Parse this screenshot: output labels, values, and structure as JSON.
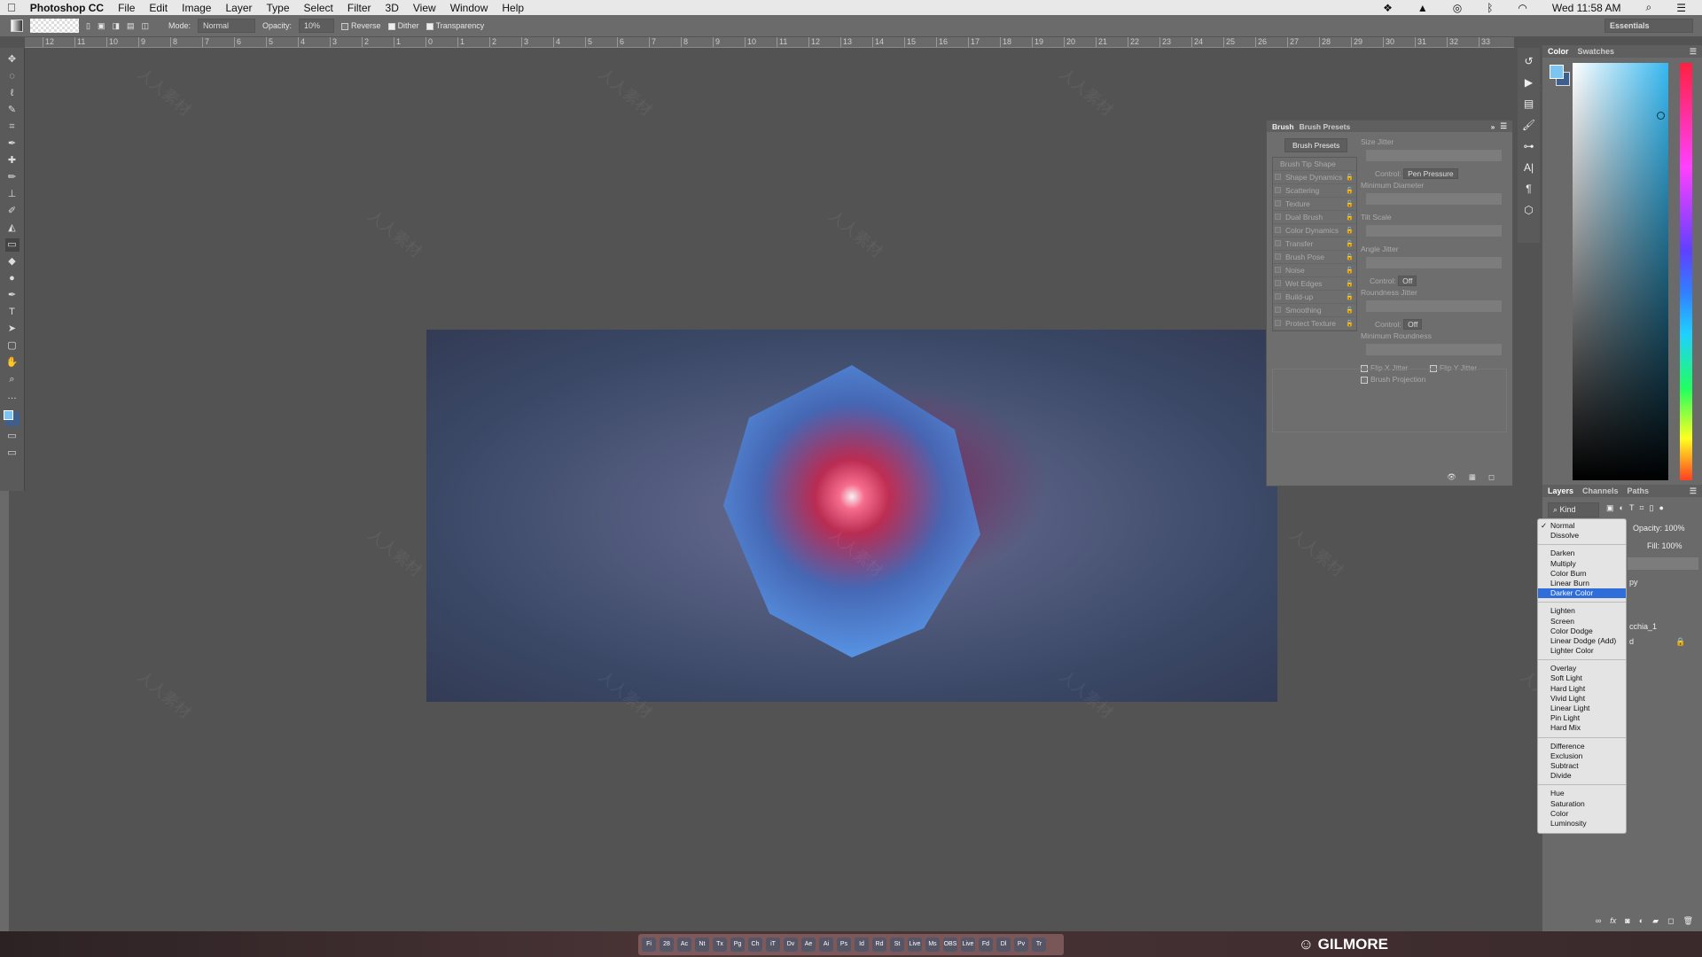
{
  "menubar": {
    "app": "Photoshop CC",
    "items": [
      "File",
      "Edit",
      "Image",
      "Layer",
      "Type",
      "Select",
      "Filter",
      "3D",
      "View",
      "Window",
      "Help"
    ],
    "clock": "Wed 11:58 AM",
    "status_icons": [
      "dropbox-icon",
      "drive-icon",
      "creative-cloud-icon",
      "bluetooth-icon",
      "wifi-icon",
      "search-icon",
      "list-icon"
    ]
  },
  "options": {
    "mode_label": "Mode:",
    "mode_value": "Normal",
    "opacity_label": "Opacity:",
    "opacity_value": "10%",
    "reverse": "Reverse",
    "reverse_checked": false,
    "dither": "Dither",
    "dither_checked": true,
    "transparency": "Transparency",
    "transparency_checked": true,
    "workspace": "Essentials"
  },
  "ruler": [
    "12",
    "11",
    "10",
    "9",
    "8",
    "7",
    "6",
    "5",
    "4",
    "3",
    "2",
    "1",
    "0",
    "1",
    "2",
    "3",
    "4",
    "5",
    "6",
    "7",
    "8",
    "9",
    "10",
    "11",
    "12",
    "13",
    "14",
    "15",
    "16",
    "17",
    "18",
    "19",
    "20",
    "21",
    "22",
    "23",
    "24",
    "25",
    "26",
    "27",
    "28",
    "29",
    "30",
    "31",
    "32",
    "33"
  ],
  "tools": [
    "move",
    "marquee",
    "lasso",
    "quick-select",
    "crop",
    "eyedropper",
    "healing",
    "brush",
    "stamp",
    "history-brush",
    "eraser",
    "gradient",
    "blur",
    "dodge",
    "pen",
    "type",
    "path-select",
    "rectangle",
    "hand",
    "zoom",
    "more"
  ],
  "brush_panel": {
    "tabs": [
      "Brush",
      "Brush Presets"
    ],
    "presets_button": "Brush Presets",
    "options": [
      {
        "label": "Brush Tip Shape",
        "lock": false
      },
      {
        "label": "Shape Dynamics",
        "lock": true
      },
      {
        "label": "Scattering",
        "lock": true
      },
      {
        "label": "Texture",
        "lock": true
      },
      {
        "label": "Dual Brush",
        "lock": true
      },
      {
        "label": "Color Dynamics",
        "lock": true
      },
      {
        "label": "Transfer",
        "lock": true
      },
      {
        "label": "Brush Pose",
        "lock": true
      },
      {
        "label": "Noise",
        "lock": true
      },
      {
        "label": "Wet Edges",
        "lock": true
      },
      {
        "label": "Build-up",
        "lock": true
      },
      {
        "label": "Smoothing",
        "lock": true
      },
      {
        "label": "Protect Texture",
        "lock": true
      }
    ],
    "size_jitter": "Size Jitter",
    "control1_label": "Control:",
    "control1_value": "Pen Pressure",
    "min_diameter": "Minimum Diameter",
    "tilt_scale": "Tilt Scale",
    "angle_jitter": "Angle Jitter",
    "control2_label": "Control:",
    "control2_value": "Off",
    "roundness_jitter": "Roundness Jitter",
    "control3_label": "Control:",
    "control3_value": "Off",
    "min_roundness": "Minimum Roundness",
    "flip_x": "Flip X Jitter",
    "flip_y": "Flip Y Jitter",
    "projection": "Brush Projection"
  },
  "color_panel": {
    "tabs": [
      "Color",
      "Swatches"
    ],
    "foreground": "#7cc4f2",
    "background": "#3e5e8e"
  },
  "layers_panel": {
    "tabs": [
      "Layers",
      "Channels",
      "Paths"
    ],
    "filter": "Kind",
    "opacity_label": "Opacity:",
    "opacity_value": "100%",
    "fill_label": "Fill:",
    "fill_value": "100%",
    "layer_fragments": [
      "py",
      "cchia_1",
      "d"
    ]
  },
  "blend_menu": {
    "groups": [
      [
        "Normal",
        "Dissolve"
      ],
      [
        "Darken",
        "Multiply",
        "Color Burn",
        "Linear Burn",
        "Darker Color"
      ],
      [
        "Lighten",
        "Screen",
        "Color Dodge",
        "Linear Dodge (Add)",
        "Lighter Color"
      ],
      [
        "Overlay",
        "Soft Light",
        "Hard Light",
        "Vivid Light",
        "Linear Light",
        "Pin Light",
        "Hard Mix"
      ],
      [
        "Difference",
        "Exclusion",
        "Subtract",
        "Divide"
      ],
      [
        "Hue",
        "Saturation",
        "Color",
        "Luminosity"
      ]
    ],
    "checked": "Normal",
    "highlighted": "Darker Color"
  },
  "dock": {
    "apps": [
      "Fi",
      "28",
      "Ac",
      "Nt",
      "Tx",
      "Pg",
      "Ch",
      "iT",
      "Dv",
      "Ae",
      "Ai",
      "Ps",
      "Id",
      "Rd",
      "St",
      "Live",
      "Ms",
      "OBS",
      "Live",
      "Fd",
      "Dl",
      "Pv",
      "Tr"
    ]
  },
  "watermark": {
    "logo_text": "人人素材",
    "brand": "GILMORE"
  },
  "accent": "#2f6ed8"
}
